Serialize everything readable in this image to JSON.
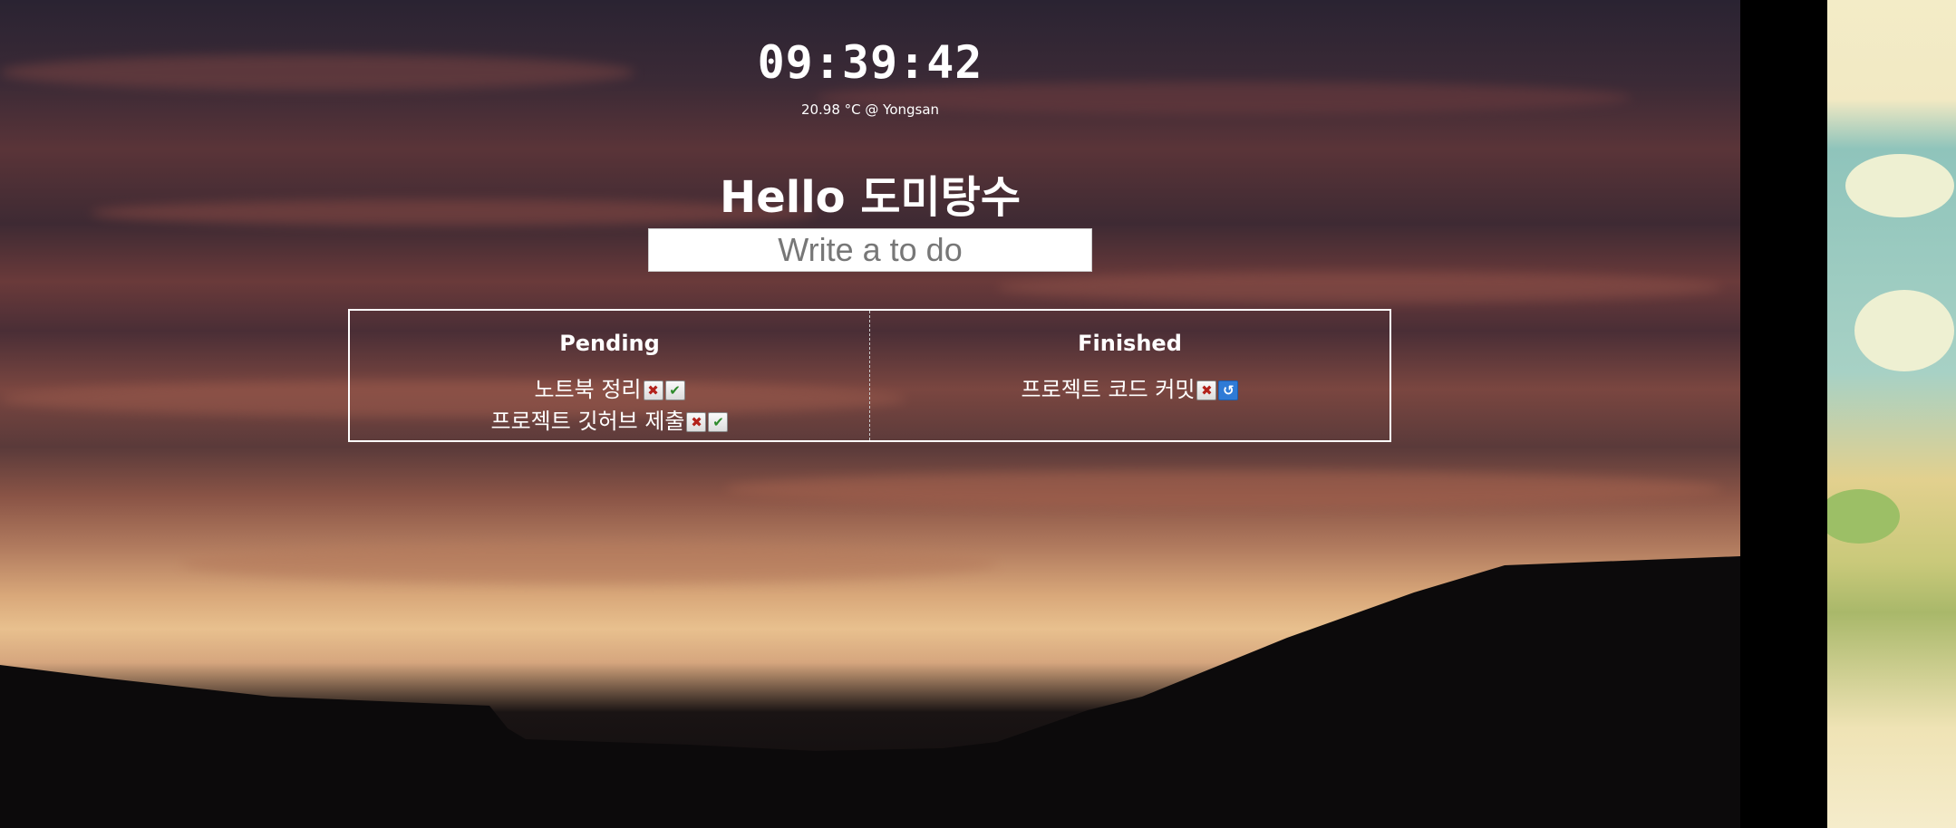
{
  "clock": {
    "time": "09:39:42"
  },
  "weather": {
    "text": "20.98 °C @ Yongsan"
  },
  "greeting": {
    "text": "Hello 도미탕수"
  },
  "todo_input": {
    "placeholder": "Write a to do",
    "value": ""
  },
  "pending": {
    "title": "Pending",
    "items": [
      {
        "text": "노트북 정리",
        "delete_icon": "✖",
        "finish_icon": "✔"
      },
      {
        "text": "프로젝트 깃허브 제출",
        "delete_icon": "✖",
        "finish_icon": "✔"
      }
    ]
  },
  "finished": {
    "title": "Finished",
    "items": [
      {
        "text": "프로젝트 코드 커밋",
        "delete_icon": "✖",
        "restore_icon": "↺"
      }
    ]
  },
  "colors": {
    "text": "#ffffff",
    "delete_button": "#b3221b",
    "finish_button": "#2d8a2a",
    "restore_button": "#2f7bd6"
  }
}
